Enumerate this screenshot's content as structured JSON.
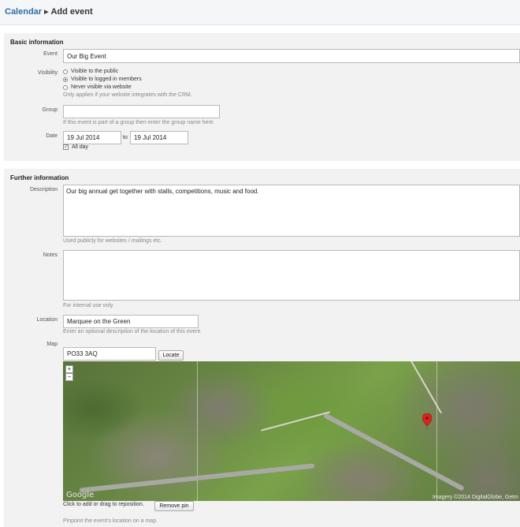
{
  "breadcrumb": {
    "root": "Calendar",
    "current": "Add event"
  },
  "basic": {
    "title": "Basic information",
    "event_label": "Event",
    "event_value": "Our Big Event",
    "visibility_label": "Visibility",
    "visibility_options": [
      "Visible to the public",
      "Visible to logged in members",
      "Never visible via website"
    ],
    "visibility_selected": "Visible to logged in members",
    "visibility_hint": "Only applies if your website integrates with the CRM.",
    "group_label": "Group",
    "group_value": "",
    "group_hint": "If this event is part of a group then enter the group name here.",
    "date_label": "Date",
    "date_from": "19 Jul 2014",
    "date_to_label": "to",
    "date_to": "19 Jul 2014",
    "allday_label": "All day",
    "allday_checked": true
  },
  "further": {
    "title": "Further information",
    "description_label": "Description",
    "description_value": "Our big annual get together with stalls, competitions, music and food.",
    "description_hint": "Used publicly for websites / mailings etc.",
    "notes_label": "Notes",
    "notes_value": "",
    "notes_hint": "For internal use only.",
    "location_label": "Location",
    "location_value": "Marquee on the Green",
    "location_hint": "Enter an optional description of the location of this event.",
    "map_label": "Map",
    "postcode_value": "PO33 3AQ",
    "locate_label": "Locate",
    "map_logo": "Google",
    "map_attribution": "Imagery ©2014 DigitalGlobe, Getm",
    "zoom_in": "+",
    "zoom_out": "−",
    "map_click_hint": "Click to add or drag to reposition.",
    "remove_pin_label": "Remove pin",
    "map_hint": "Pinpoint the event's location on a map."
  },
  "colors": {
    "link": "#2f6fa7",
    "panel": "#f2f2f2",
    "pin": "#d9261c"
  }
}
